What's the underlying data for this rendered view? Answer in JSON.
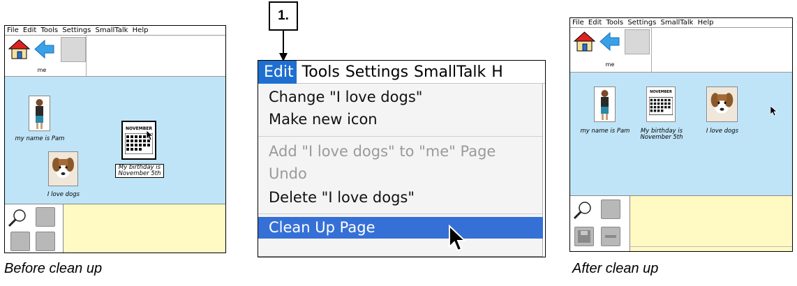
{
  "menubar_items": [
    "File",
    "Edit",
    "Tools",
    "Settings",
    "SmallTalk",
    "Help"
  ],
  "toolbar_label": "me",
  "icons": {
    "pam": "my name is Pam",
    "birthday_line1": "My birthday is",
    "birthday_line2": "November 5th",
    "dogs": "I love dogs",
    "calendar_month": "NOVEMBER"
  },
  "captions": {
    "before": "Before clean up",
    "after": "After clean up"
  },
  "step_label": "1.",
  "edit_menu": {
    "menubar": [
      "Edit",
      "Tools",
      "Settings",
      "SmallTalk",
      "H"
    ],
    "items": [
      {
        "label": "Change \"I love dogs\"",
        "enabled": true
      },
      {
        "label": "Make new icon",
        "enabled": true
      },
      {
        "label": "Add \"I love dogs\" to \"me\" Page",
        "enabled": false
      },
      {
        "label": "Undo",
        "enabled": false
      },
      {
        "label": "Delete \"I love dogs\"",
        "enabled": true
      },
      {
        "label": "Clean Up Page",
        "enabled": true,
        "highlighted": true
      }
    ]
  },
  "colors": {
    "page_bg": "#bfe4f7",
    "bottom_bg": "#fff9c4",
    "menu_highlight": "#3570d6"
  }
}
